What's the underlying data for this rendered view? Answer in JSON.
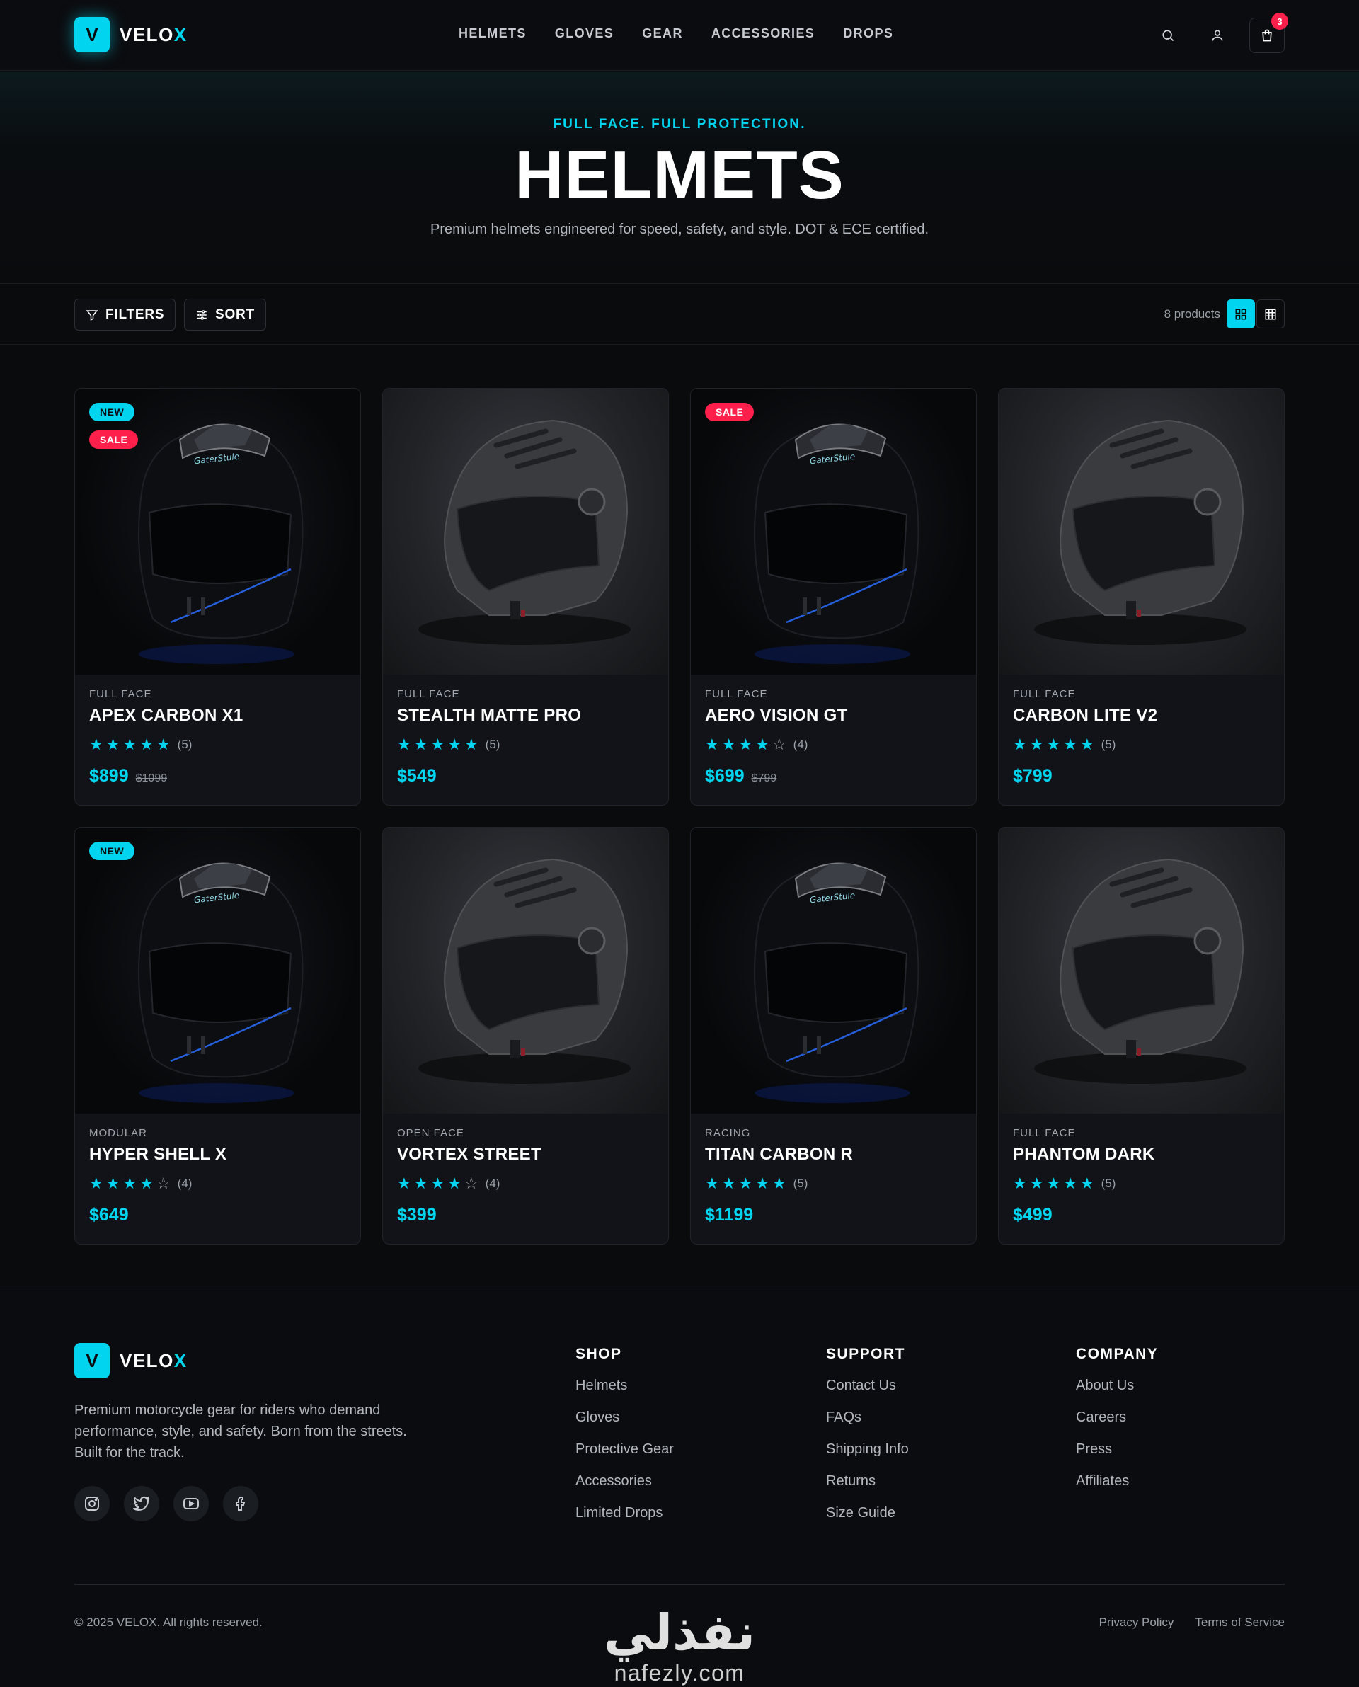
{
  "brand": {
    "mark": "V",
    "name_main": "VELO",
    "name_accent": "X",
    "accent_color": "#00d4ee",
    "sale_color": "#ff1f4b"
  },
  "nav": {
    "links": [
      "HELMETS",
      "GLOVES",
      "GEAR",
      "ACCESSORIES",
      "DROPS"
    ],
    "icons": [
      "search-icon",
      "user-icon",
      "shopping-bag-icon"
    ],
    "cart_count": "3"
  },
  "hero": {
    "eyebrow": "FULL FACE. FULL PROTECTION.",
    "title": "HELMETS",
    "subtitle": "Premium helmets engineered for speed, safety, and style. DOT & ECE certified."
  },
  "toolbar": {
    "filters_label": "FILTERS",
    "sort_label": "SORT",
    "count_label": "8 products",
    "view_mode": "grid-2x2"
  },
  "products": [
    {
      "category": "FULL FACE",
      "name": "APEX CARBON X1",
      "rating": 5,
      "rating_label": "(5)",
      "price": "$899",
      "old_price": "$1099",
      "badges": [
        "NEW",
        "SALE"
      ],
      "image": "full-face-helmet"
    },
    {
      "category": "FULL FACE",
      "name": "STEALTH MATTE PRO",
      "rating": 5,
      "rating_label": "(5)",
      "price": "$549",
      "old_price": "",
      "badges": [],
      "image": "open-face-helmet"
    },
    {
      "category": "FULL FACE",
      "name": "AERO VISION GT",
      "rating": 4,
      "rating_label": "(4)",
      "price": "$699",
      "old_price": "$799",
      "badges": [
        "SALE"
      ],
      "image": "full-face-helmet"
    },
    {
      "category": "FULL FACE",
      "name": "CARBON LITE V2",
      "rating": 5,
      "rating_label": "(5)",
      "price": "$799",
      "old_price": "",
      "badges": [],
      "image": "open-face-helmet"
    },
    {
      "category": "MODULAR",
      "name": "HYPER SHELL X",
      "rating": 4,
      "rating_label": "(4)",
      "price": "$649",
      "old_price": "",
      "badges": [
        "NEW"
      ],
      "image": "full-face-helmet"
    },
    {
      "category": "OPEN FACE",
      "name": "VORTEX STREET",
      "rating": 4,
      "rating_label": "(4)",
      "price": "$399",
      "old_price": "",
      "badges": [],
      "image": "open-face-helmet"
    },
    {
      "category": "RACING",
      "name": "TITAN CARBON R",
      "rating": 5,
      "rating_label": "(5)",
      "price": "$1199",
      "old_price": "",
      "badges": [],
      "image": "full-face-helmet"
    },
    {
      "category": "FULL FACE",
      "name": "PHANTOM DARK",
      "rating": 5,
      "rating_label": "(5)",
      "price": "$499",
      "old_price": "",
      "badges": [],
      "image": "open-face-helmet"
    }
  ],
  "footer": {
    "description": "Premium motorcycle gear for riders who demand performance, style, and safety. Born from the streets. Built for the track.",
    "socials": [
      "instagram-icon",
      "twitter-icon",
      "youtube-icon",
      "facebook-icon"
    ],
    "columns": [
      {
        "title": "SHOP",
        "links": [
          "Helmets",
          "Gloves",
          "Protective Gear",
          "Accessories",
          "Limited Drops"
        ]
      },
      {
        "title": "SUPPORT",
        "links": [
          "Contact Us",
          "FAQs",
          "Shipping Info",
          "Returns",
          "Size Guide"
        ]
      },
      {
        "title": "COMPANY",
        "links": [
          "About Us",
          "Careers",
          "Press",
          "Affiliates"
        ]
      }
    ],
    "copyright": "© 2025 VELOX. All rights reserved.",
    "legal": [
      "Privacy Policy",
      "Terms of Service"
    ],
    "watermark_ar": "نفذلي",
    "watermark_en": "nafezly.com"
  }
}
